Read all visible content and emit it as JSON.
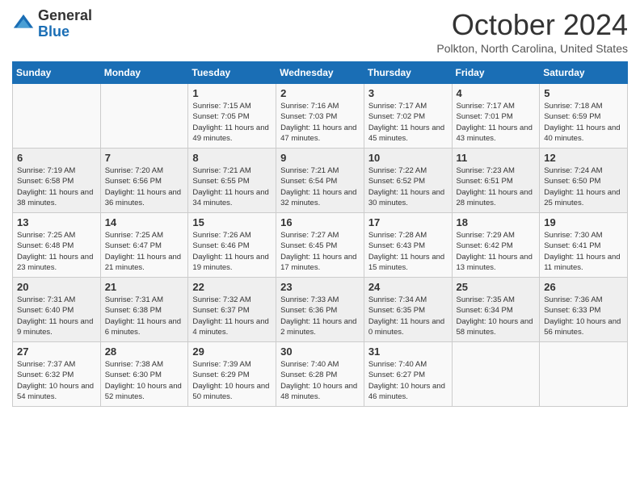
{
  "header": {
    "logo_general": "General",
    "logo_blue": "Blue",
    "month_title": "October 2024",
    "location": "Polkton, North Carolina, United States"
  },
  "days_of_week": [
    "Sunday",
    "Monday",
    "Tuesday",
    "Wednesday",
    "Thursday",
    "Friday",
    "Saturday"
  ],
  "weeks": [
    [
      {
        "day": "",
        "info": ""
      },
      {
        "day": "",
        "info": ""
      },
      {
        "day": "1",
        "info": "Sunrise: 7:15 AM\nSunset: 7:05 PM\nDaylight: 11 hours and 49 minutes."
      },
      {
        "day": "2",
        "info": "Sunrise: 7:16 AM\nSunset: 7:03 PM\nDaylight: 11 hours and 47 minutes."
      },
      {
        "day": "3",
        "info": "Sunrise: 7:17 AM\nSunset: 7:02 PM\nDaylight: 11 hours and 45 minutes."
      },
      {
        "day": "4",
        "info": "Sunrise: 7:17 AM\nSunset: 7:01 PM\nDaylight: 11 hours and 43 minutes."
      },
      {
        "day": "5",
        "info": "Sunrise: 7:18 AM\nSunset: 6:59 PM\nDaylight: 11 hours and 40 minutes."
      }
    ],
    [
      {
        "day": "6",
        "info": "Sunrise: 7:19 AM\nSunset: 6:58 PM\nDaylight: 11 hours and 38 minutes."
      },
      {
        "day": "7",
        "info": "Sunrise: 7:20 AM\nSunset: 6:56 PM\nDaylight: 11 hours and 36 minutes."
      },
      {
        "day": "8",
        "info": "Sunrise: 7:21 AM\nSunset: 6:55 PM\nDaylight: 11 hours and 34 minutes."
      },
      {
        "day": "9",
        "info": "Sunrise: 7:21 AM\nSunset: 6:54 PM\nDaylight: 11 hours and 32 minutes."
      },
      {
        "day": "10",
        "info": "Sunrise: 7:22 AM\nSunset: 6:52 PM\nDaylight: 11 hours and 30 minutes."
      },
      {
        "day": "11",
        "info": "Sunrise: 7:23 AM\nSunset: 6:51 PM\nDaylight: 11 hours and 28 minutes."
      },
      {
        "day": "12",
        "info": "Sunrise: 7:24 AM\nSunset: 6:50 PM\nDaylight: 11 hours and 25 minutes."
      }
    ],
    [
      {
        "day": "13",
        "info": "Sunrise: 7:25 AM\nSunset: 6:48 PM\nDaylight: 11 hours and 23 minutes."
      },
      {
        "day": "14",
        "info": "Sunrise: 7:25 AM\nSunset: 6:47 PM\nDaylight: 11 hours and 21 minutes."
      },
      {
        "day": "15",
        "info": "Sunrise: 7:26 AM\nSunset: 6:46 PM\nDaylight: 11 hours and 19 minutes."
      },
      {
        "day": "16",
        "info": "Sunrise: 7:27 AM\nSunset: 6:45 PM\nDaylight: 11 hours and 17 minutes."
      },
      {
        "day": "17",
        "info": "Sunrise: 7:28 AM\nSunset: 6:43 PM\nDaylight: 11 hours and 15 minutes."
      },
      {
        "day": "18",
        "info": "Sunrise: 7:29 AM\nSunset: 6:42 PM\nDaylight: 11 hours and 13 minutes."
      },
      {
        "day": "19",
        "info": "Sunrise: 7:30 AM\nSunset: 6:41 PM\nDaylight: 11 hours and 11 minutes."
      }
    ],
    [
      {
        "day": "20",
        "info": "Sunrise: 7:31 AM\nSunset: 6:40 PM\nDaylight: 11 hours and 9 minutes."
      },
      {
        "day": "21",
        "info": "Sunrise: 7:31 AM\nSunset: 6:38 PM\nDaylight: 11 hours and 6 minutes."
      },
      {
        "day": "22",
        "info": "Sunrise: 7:32 AM\nSunset: 6:37 PM\nDaylight: 11 hours and 4 minutes."
      },
      {
        "day": "23",
        "info": "Sunrise: 7:33 AM\nSunset: 6:36 PM\nDaylight: 11 hours and 2 minutes."
      },
      {
        "day": "24",
        "info": "Sunrise: 7:34 AM\nSunset: 6:35 PM\nDaylight: 11 hours and 0 minutes."
      },
      {
        "day": "25",
        "info": "Sunrise: 7:35 AM\nSunset: 6:34 PM\nDaylight: 10 hours and 58 minutes."
      },
      {
        "day": "26",
        "info": "Sunrise: 7:36 AM\nSunset: 6:33 PM\nDaylight: 10 hours and 56 minutes."
      }
    ],
    [
      {
        "day": "27",
        "info": "Sunrise: 7:37 AM\nSunset: 6:32 PM\nDaylight: 10 hours and 54 minutes."
      },
      {
        "day": "28",
        "info": "Sunrise: 7:38 AM\nSunset: 6:30 PM\nDaylight: 10 hours and 52 minutes."
      },
      {
        "day": "29",
        "info": "Sunrise: 7:39 AM\nSunset: 6:29 PM\nDaylight: 10 hours and 50 minutes."
      },
      {
        "day": "30",
        "info": "Sunrise: 7:40 AM\nSunset: 6:28 PM\nDaylight: 10 hours and 48 minutes."
      },
      {
        "day": "31",
        "info": "Sunrise: 7:40 AM\nSunset: 6:27 PM\nDaylight: 10 hours and 46 minutes."
      },
      {
        "day": "",
        "info": ""
      },
      {
        "day": "",
        "info": ""
      }
    ]
  ]
}
